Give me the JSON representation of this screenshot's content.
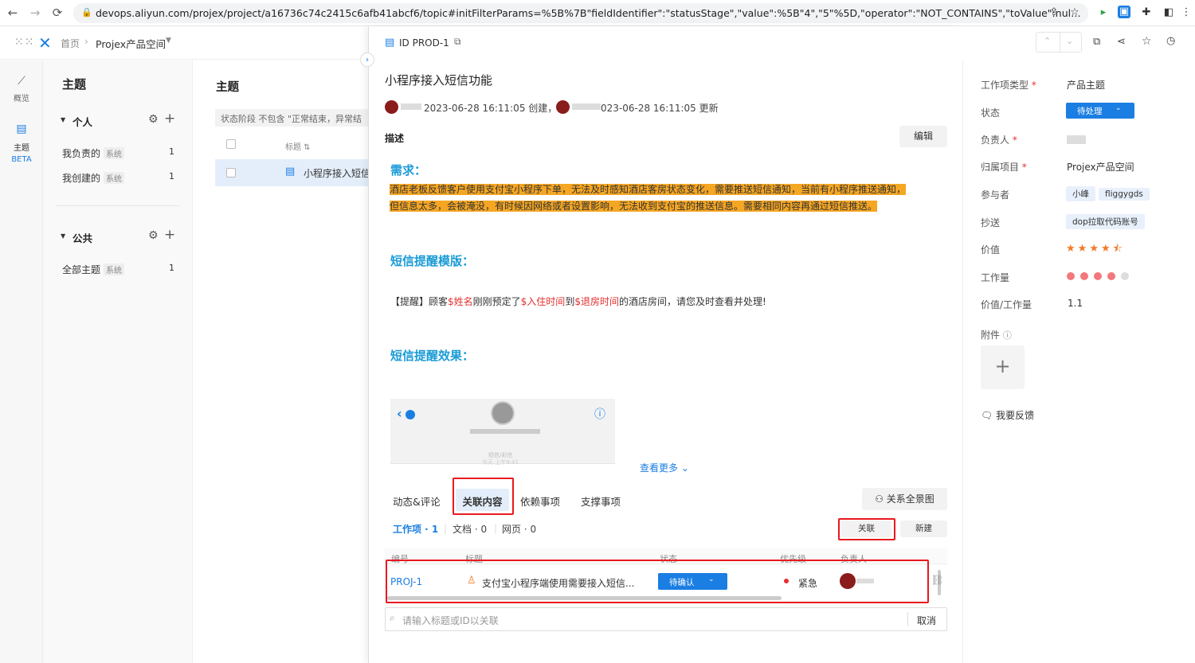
{
  "browser": {
    "url": "devops.aliyun.com/projex/project/a16736c74c2415c6afb41abcf6/topic#initFilterParams=%5B%7B\"fieldIdentifier\":\"statusStage\",\"value\":%5B\"4\",\"5\"%5D,\"operator\":\"NOT_CONTAINS\",\"toValue\":null,\"classNam..."
  },
  "appbar": {
    "home": "首页",
    "project": "Projex产品空间"
  },
  "rail": {
    "overview": "概览",
    "topic": "主题",
    "beta": "BETA"
  },
  "sidebar": {
    "title": "主题",
    "personal_label": "个人",
    "personal_items": [
      {
        "label": "我负责的",
        "tag": "系统",
        "count": "1"
      },
      {
        "label": "我创建的",
        "tag": "系统",
        "count": "1"
      }
    ],
    "public_label": "公共",
    "public_items": [
      {
        "label": "全部主题",
        "tag": "系统",
        "count": "1"
      }
    ]
  },
  "list": {
    "title": "主题",
    "filter": "状态阶段 不包含 \"正常结束，异常结",
    "col_title": "标题",
    "row_title": "小程序接入短信"
  },
  "detail": {
    "id": "ID PROD-1",
    "title": "小程序接入短信功能",
    "meta_created": "2023-06-28 16:11:05 创建，",
    "meta_updated": "023-06-28 16:11:05 更新",
    "desc_label": "描述",
    "edit_label": "编辑",
    "h_req": "需求：",
    "req_line1": "酒店老板反馈客户使用支付宝小程序下单，无法及时感知酒店客房状态变化，需要推送短信通知，当前有小程序推送通知，",
    "req_line2": "但信息太多，会被淹没，有时候因网络或者设置影响，无法收到支付宝的推送信息。需要相同内容再通过短信推送。",
    "h_tpl": "短信提醒模版：",
    "tpl_p1": "【提醒】顾客",
    "tpl_v1": "$姓名",
    "tpl_p2": "刚刚预定了",
    "tpl_v2": "$入住时间",
    "tpl_p3": "到",
    "tpl_v3": "$退房时间",
    "tpl_p4": "的酒店房间，请您及时查看并处理!",
    "h_effect": "短信提醒效果：",
    "phone_sub": "短信/彩信",
    "phone_time": "今天 上午9:41",
    "more": "查看更多",
    "tabs": [
      "动态&评论",
      "关联内容",
      "依赖事项",
      "支撑事项"
    ],
    "graph_btn": "关系全景图",
    "subtabs": [
      "工作项 · 1",
      "文档 · 0",
      "网页 · 0"
    ],
    "link_btn": "关联",
    "new_btn": "新建",
    "cols": [
      "编号",
      "标题",
      "状态",
      "优先级",
      "负责人"
    ],
    "row": {
      "id": "PROJ-1",
      "title": "支付宝小程序端使用需要接入短信...",
      "status": "待确认",
      "priority": "紧急"
    },
    "search_placeholder": "请输入标题或ID以关联",
    "cancel": "取消"
  },
  "props": {
    "type_label": "工作项类型",
    "type_value": "产品主题",
    "status_label": "状态",
    "status_value": "待处理",
    "owner_label": "负责人",
    "project_label": "归属项目",
    "project_value": "Projex产品空间",
    "participants_label": "参与者",
    "participants": [
      "小峰",
      "fliggygds"
    ],
    "cc_label": "抄送",
    "cc": [
      "dop拉取代码账号"
    ],
    "value_label": "价值",
    "value_rating": 4.5,
    "effort_label": "工作量",
    "effort_level": 4,
    "ratio_label": "价值/工作量",
    "ratio_value": "1.1",
    "attach_label": "附件",
    "feedback": "我要反馈"
  },
  "colors": {
    "accent": "#1b7ee3",
    "highlight": "#f5a623",
    "annotation": "#e8191e",
    "star": "#f07a2a",
    "effort": "#f2787d"
  }
}
